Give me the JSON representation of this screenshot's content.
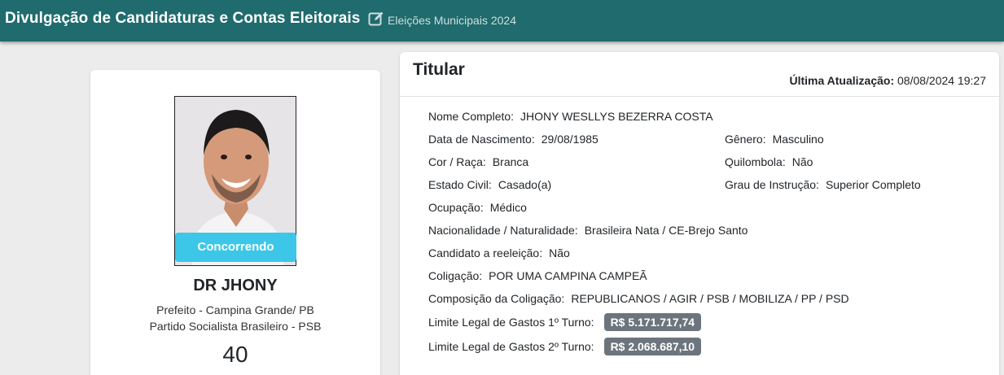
{
  "header": {
    "title": "Divulgação de Candidaturas e Contas Eleitorais",
    "election": "Eleições Municipais 2024"
  },
  "candidate": {
    "status": "Concorrendo",
    "name": "DR JHONY",
    "office": "Prefeito - Campina Grande/ PB",
    "party": "Partido Socialista Brasileiro - PSB",
    "number": "40"
  },
  "details": {
    "section_title": "Titular",
    "updated_label": "Última Atualização:",
    "updated_value": "08/08/2024 19:27",
    "fields": {
      "nome_label": "Nome Completo:",
      "nome": "JHONY WESLLYS BEZERRA COSTA",
      "nasc_label": "Data de Nascimento:",
      "nasc": "29/08/1985",
      "genero_label": "Gênero:",
      "genero": "Masculino",
      "cor_label": "Cor / Raça:",
      "cor": "Branca",
      "quilombola_label": "Quilombola:",
      "quilombola": "Não",
      "civil_label": "Estado Civil:",
      "civil": "Casado(a)",
      "instrucao_label": "Grau de Instrução:",
      "instrucao": "Superior Completo",
      "ocupacao_label": "Ocupação:",
      "ocupacao": "Médico",
      "nacionalidade_label": "Nacionalidade / Naturalidade:",
      "nacionalidade": "Brasileira Nata / CE-Brejo Santo",
      "reeleicao_label": "Candidato a reeleição:",
      "reeleicao": "Não",
      "coligacao_label": "Coligação:",
      "coligacao": "POR UMA CAMPINA CAMPEÃ",
      "composicao_label": "Composição da Coligação:",
      "composicao": "REPUBLICANOS / AGIR / PSB / MOBILIZA / PP / PSD",
      "limite1_label": "Limite Legal de Gastos 1º Turno:",
      "limite1": "R$ 5.171.717,74",
      "limite2_label": "Limite Legal de Gastos 2º Turno:",
      "limite2": "R$ 2.068.687,10"
    }
  },
  "icons": {
    "edit": "edit-square-icon"
  },
  "colors": {
    "topbar": "#1f6b6e",
    "status_badge": "#3cc7e9",
    "money_badge": "#6c757d"
  }
}
